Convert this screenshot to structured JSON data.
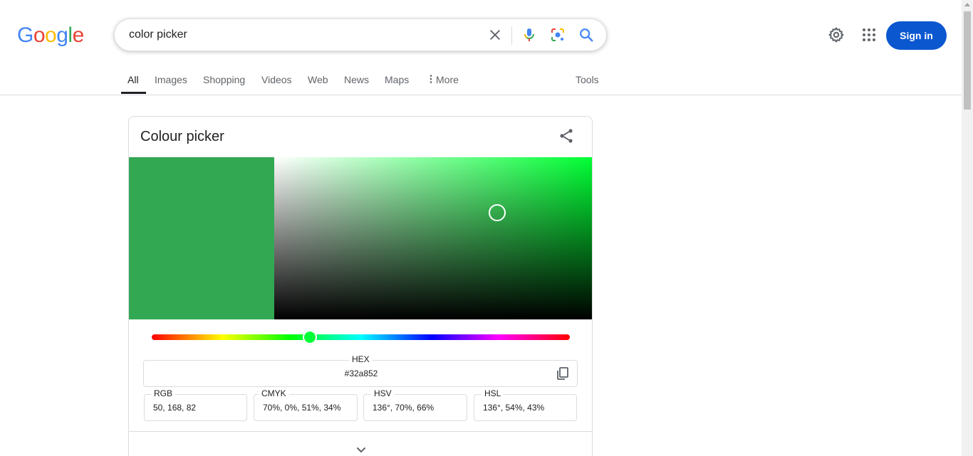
{
  "logo": {
    "text": "Google",
    "letters": [
      "G",
      "o",
      "o",
      "g",
      "l",
      "e"
    ],
    "colors": [
      "#4285F4",
      "#EA4335",
      "#FBBC05",
      "#4285F4",
      "#34A853",
      "#EA4335"
    ]
  },
  "search": {
    "value": "color picker",
    "icons": [
      "close-icon",
      "mic-icon",
      "lens-icon",
      "search-icon"
    ]
  },
  "header": {
    "signin_label": "Sign in",
    "icons": [
      "settings-icon",
      "apps-icon"
    ]
  },
  "tabs": [
    {
      "label": "All",
      "active": true
    },
    {
      "label": "Images"
    },
    {
      "label": "Shopping"
    },
    {
      "label": "Videos"
    },
    {
      "label": "Web"
    },
    {
      "label": "News"
    },
    {
      "label": "Maps"
    },
    {
      "label": "More",
      "icon": "more-vert-icon"
    }
  ],
  "tools_label": "Tools",
  "picker": {
    "title": "Colour picker",
    "selected_color": "#32a852",
    "hue_color": "#00ff37",
    "hue_fraction": 0.378,
    "saturation": 0.7,
    "value": 0.66,
    "hex": {
      "label": "HEX",
      "value": "#32a852"
    },
    "rgb": {
      "label": "RGB",
      "value": "50, 168, 82"
    },
    "cmyk": {
      "label": "CMYK",
      "value": "70%, 0%, 51%, 34%"
    },
    "hsv": {
      "label": "HSV",
      "value": "136°, 70%, 66%"
    },
    "hsl": {
      "label": "HSL",
      "value": "136°, 54%, 43%"
    }
  },
  "colors": {
    "accent": "#0b57d0",
    "text": "#202124",
    "muted": "#5f6368"
  }
}
